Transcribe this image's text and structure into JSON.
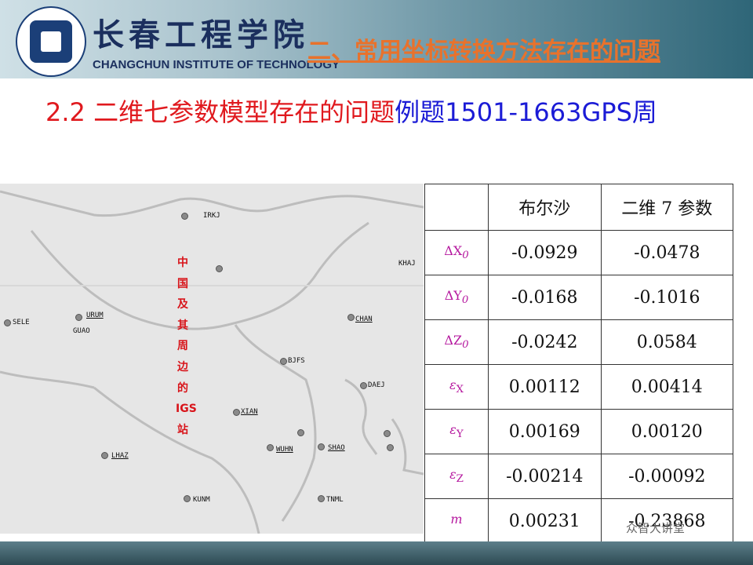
{
  "header": {
    "college_cn": "长春工程学院",
    "college_en": "CHANGCHUN INSTITUTE OF TECHNOLOGY",
    "section_title": "二、常用坐标转换方法存在的问题"
  },
  "slide": {
    "title_red": "2.2 二维七参数模型存在的问题",
    "title_blue": "例题1501-1663GPS周"
  },
  "map": {
    "vertical_label": [
      "中",
      "国",
      "及",
      "其",
      "周",
      "边",
      "的",
      "IGS",
      "站"
    ],
    "stations": {
      "IRKJ": "IRKJ",
      "KHAJ": "KHAJ",
      "SELE": "SELE",
      "URUM": "URUM",
      "GUAO": "GUAO",
      "CHAN": "CHAN",
      "BJFS": "BJFS",
      "DAEJ": "DAEJ",
      "XIAN": "XIAN",
      "WUHN": "WUHN",
      "SHAO": "SHAO",
      "LHAZ": "LHAZ",
      "KUNM": "KUNM",
      "TNML": "TNML"
    }
  },
  "table": {
    "headers": [
      "",
      "布尔沙",
      "二维 7 参数"
    ],
    "rows": [
      {
        "sym": "ΔX",
        "sub": "0",
        "a": "-0.0929",
        "b": "-0.0478"
      },
      {
        "sym": "ΔY",
        "sub": "0",
        "a": "-0.0168",
        "b": "-0.1016"
      },
      {
        "sym": "ΔZ",
        "sub": "0",
        "a": "-0.0242",
        "b": "0.0584"
      },
      {
        "sym": "ε",
        "sub": "X",
        "a": "0.00112",
        "b": "0.00414"
      },
      {
        "sym": "ε",
        "sub": "Y",
        "a": "0.00169",
        "b": "0.00120"
      },
      {
        "sym": "ε",
        "sub": "Z",
        "a": "-0.00214",
        "b": "-0.00092"
      },
      {
        "sym": "m",
        "sub": "",
        "a": "0.00231",
        "b": "-0.23868"
      }
    ]
  },
  "watermark": "众智大讲堂"
}
